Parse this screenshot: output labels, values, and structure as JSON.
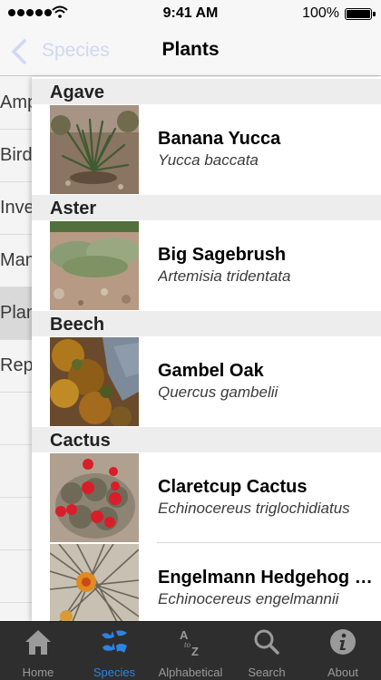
{
  "status_bar": {
    "time": "9:41 AM",
    "battery_percent": "100%"
  },
  "nav": {
    "back_label": "Species",
    "title": "Plants"
  },
  "side_menu": {
    "items": [
      {
        "label": "Amphibians",
        "selected": false
      },
      {
        "label": "Birds",
        "selected": false
      },
      {
        "label": "Invertebrates",
        "selected": false
      },
      {
        "label": "Mammals",
        "selected": false
      },
      {
        "label": "Plants",
        "selected": true
      },
      {
        "label": "Reptiles",
        "selected": false
      }
    ]
  },
  "sections": [
    {
      "header": "Agave",
      "rows": [
        {
          "common": "Banana Yucca",
          "scientific": "Yucca baccata"
        }
      ]
    },
    {
      "header": "Aster",
      "rows": [
        {
          "common": "Big Sagebrush",
          "scientific": "Artemisia tridentata"
        }
      ]
    },
    {
      "header": "Beech",
      "rows": [
        {
          "common": "Gambel Oak",
          "scientific": "Quercus gambelii"
        }
      ]
    },
    {
      "header": "Cactus",
      "rows": [
        {
          "common": "Claretcup Cactus",
          "scientific": "Echinocereus triglochidiatus"
        },
        {
          "common": "Engelmann Hedgehog Cactus",
          "scientific": "Echinocereus engelmannii"
        }
      ]
    }
  ],
  "tab_bar": {
    "active": "Species",
    "tabs": [
      {
        "label": "Home",
        "icon": "home-icon"
      },
      {
        "label": "Species",
        "icon": "bird-icon"
      },
      {
        "label": "Alphabetical",
        "icon": "alphabetical-icon"
      },
      {
        "label": "Search",
        "icon": "search-icon"
      },
      {
        "label": "About",
        "icon": "info-icon"
      }
    ],
    "active_color": "#2f83e0",
    "inactive_color": "#9a9a9a"
  }
}
